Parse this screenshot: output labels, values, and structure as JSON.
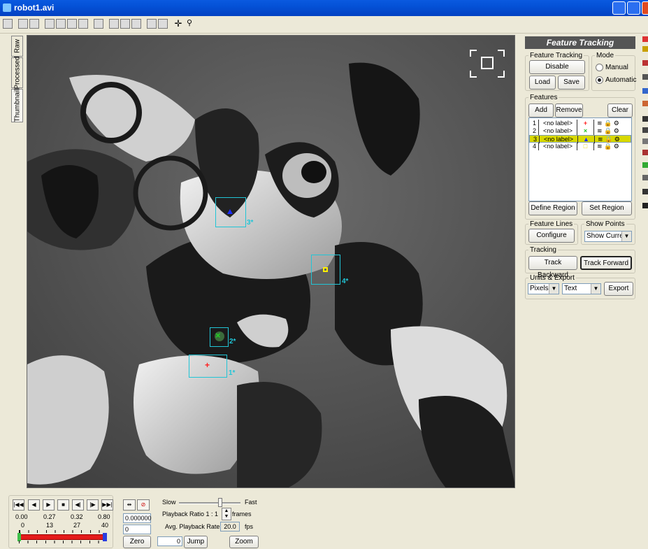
{
  "window": {
    "title": "robot1.avi"
  },
  "tabs": [
    "Raw",
    "Processed",
    "Thumbnail"
  ],
  "video": {
    "features": [
      {
        "label": "1*",
        "marker_color": "#ff2020"
      },
      {
        "label": "2*",
        "marker_color": "#22d022"
      },
      {
        "label": "3*",
        "marker_color": "#1a2cff"
      },
      {
        "label": "4*",
        "marker_color": "#ffee00"
      }
    ],
    "box_color": "#21c5d6"
  },
  "panel": {
    "title": "Feature Tracking",
    "feature_tracking": {
      "legend": "Feature Tracking",
      "disable": "Disable",
      "load": "Load",
      "save": "Save"
    },
    "mode": {
      "legend": "Mode",
      "manual": "Manual",
      "automatic": "Automatic",
      "selected": "Automatic"
    },
    "features": {
      "legend": "Features",
      "add": "Add",
      "remove": "Remove",
      "clear": "Clear",
      "rows": [
        {
          "num": "1",
          "label": "<no label>",
          "marker": "+",
          "color": "#ff2020",
          "selected": false
        },
        {
          "num": "2",
          "label": "<no label>",
          "marker": "×",
          "color": "#22c022",
          "selected": false
        },
        {
          "num": "3",
          "label": "<no label>",
          "marker": "▲",
          "color": "#1a2cff",
          "selected": true
        },
        {
          "num": "4",
          "label": "<no label>",
          "marker": "□",
          "color": "#ffee00",
          "selected": false
        }
      ],
      "define_region": "Define Region",
      "set_region": "Set Region"
    },
    "feature_lines": {
      "legend": "Feature Lines",
      "configure": "Configure"
    },
    "show_points": {
      "legend": "Show Points",
      "value": "Show Curren"
    },
    "tracking": {
      "legend": "Tracking",
      "backward": "Track Backward",
      "forward": "Track Forward"
    },
    "units_export": {
      "legend": "Units & Export",
      "units": "Pixels",
      "format": "Text",
      "export": "Export"
    }
  },
  "playback": {
    "time_ticks": [
      "0.00",
      "0.27",
      "0.32",
      "0.80"
    ],
    "frame_ticks": [
      "0",
      "13",
      "27",
      "40"
    ],
    "time_value": "0.000000",
    "frame_value": "0",
    "zero": "Zero",
    "jump_value": "0",
    "jump": "Jump",
    "slow": "Slow",
    "fast": "Fast",
    "speed_level": 0.68,
    "playback_ratio_label": "Playback Ratio",
    "playback_ratio": "1 : 1",
    "frames_label": "frames",
    "avg_rate_label": "Avg. Playback Rate",
    "avg_rate": "20.0",
    "fps": "fps",
    "zoom": "Zoom"
  }
}
